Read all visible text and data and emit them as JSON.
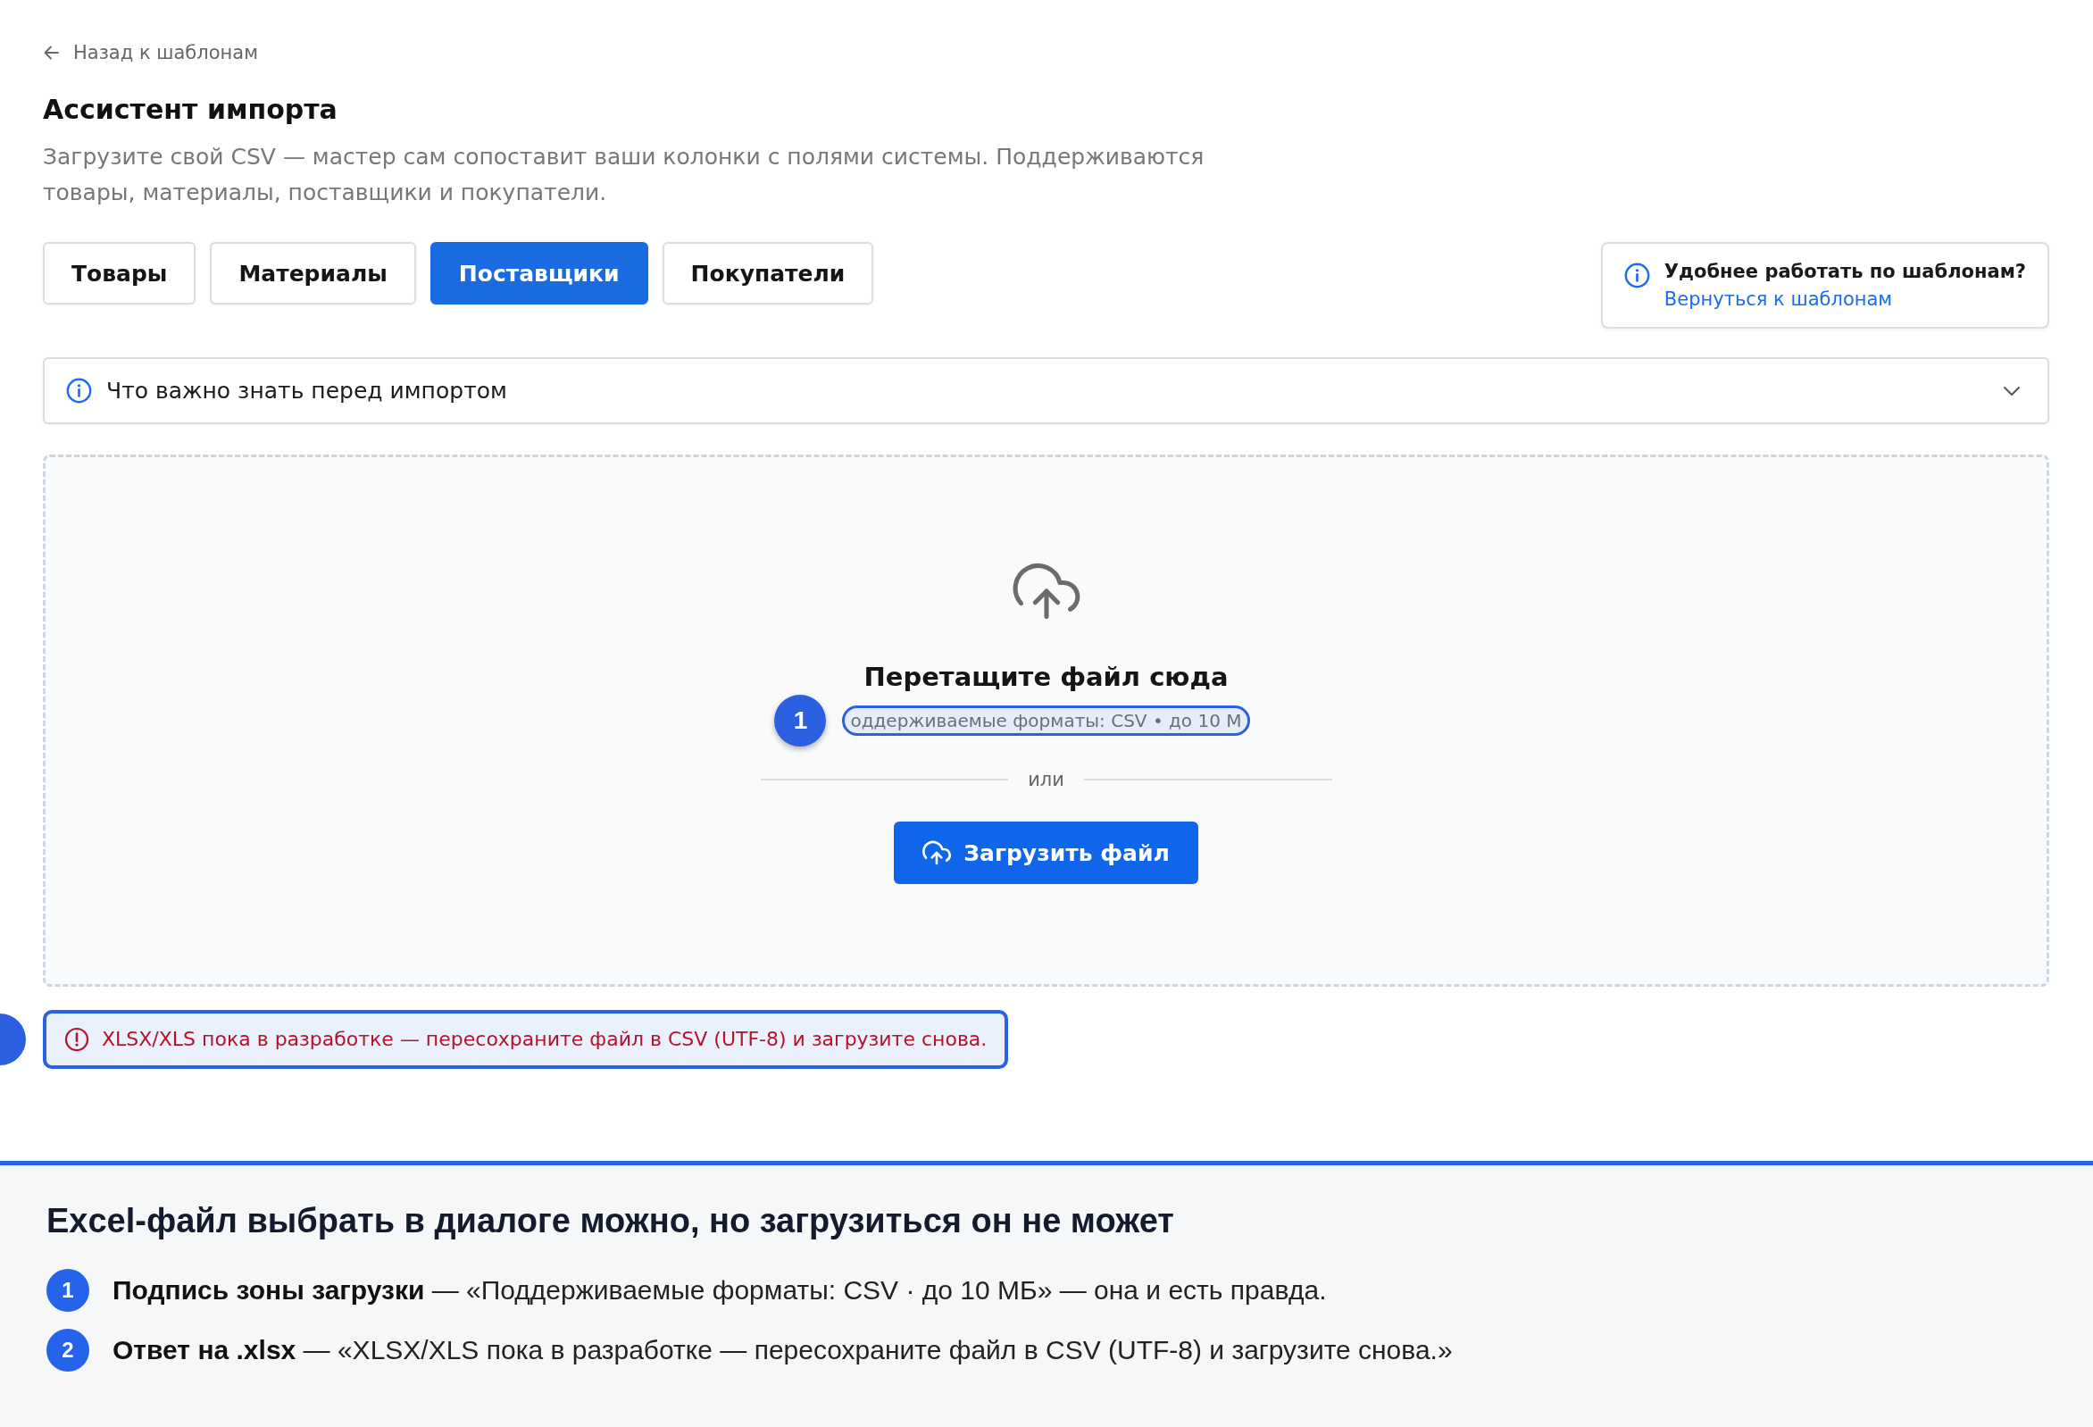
{
  "back_link": {
    "label": "Назад к шаблонам"
  },
  "header": {
    "title": "Ассистент импорта",
    "description": "Загрузите свой CSV — мастер сам сопоставит ваши колонки с полями системы. Поддерживаются товары, материалы, поставщики и покупатели."
  },
  "tabs": [
    {
      "label": "Товары",
      "selected": false
    },
    {
      "label": "Материалы",
      "selected": false
    },
    {
      "label": "Поставщики",
      "selected": true
    },
    {
      "label": "Покупатели",
      "selected": false
    }
  ],
  "template_hint": {
    "title": "Удобнее работать по шаблонам?",
    "link": "Вернуться к шаблонам"
  },
  "accordion": {
    "title": "Что важно знать перед импортом",
    "expanded": false
  },
  "dropzone": {
    "title": "Перетащите файл сюда",
    "caption": {
      "text": "оддерживаемые форматы: CSV • до 10 М",
      "highlighted": true,
      "marker": "1"
    },
    "divider": "или",
    "button": "Загрузить файл"
  },
  "error": {
    "message": "XLSX/XLS пока в разработке — пересохраните файл в CSV (UTF-8) и загрузите снова.",
    "highlighted": true
  },
  "note_panel": {
    "title": "Excel-файл выбрать в диалоге можно, но загрузиться он не может",
    "items": [
      {
        "number": "1",
        "text": "**Подпись зоны загрузки** — «Поддерживаемые форматы: CSV · до 10 МБ» — она и есть правда."
      },
      {
        "number": "2",
        "text": "**Ответ на .xlsx** — «XLSX/XLS пока в разработке — пересохраните файл в CSV (UTF-8) и загрузите снова.»"
      }
    ]
  }
}
